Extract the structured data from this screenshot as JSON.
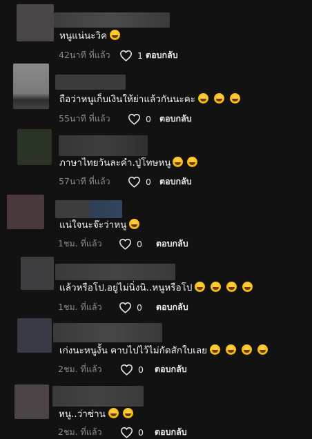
{
  "comments": [
    {
      "text": "หนูแน่นะวิค",
      "emojis": 1,
      "time": "42นาที ที่แล้ว",
      "likes": "1",
      "reply": "ตอบกลับ"
    },
    {
      "text": "ถือว่าหนูเก็บเงินให้ย่าแล้วกันนะคะ",
      "emojis": 3,
      "time": "55นาที ที่แล้ว",
      "likes": "0",
      "reply": "ตอบกลับ"
    },
    {
      "text": "ภาษาไทยวันละคำ.ปู่โทษหนู",
      "emojis": 2,
      "time": "57นาที ที่แล้ว",
      "likes": "0",
      "reply": "ตอบกลับ"
    },
    {
      "text": "แน่ใจนะจ๊ะว่าหนู",
      "emojis": 1,
      "time": "1ชม. ที่แล้ว",
      "likes": "0",
      "reply": "ตอบกลับ"
    },
    {
      "text": "แล้วหรือโป.อยู่ไม่นิ่งนิ..หนูหรือโป",
      "emojis": 4,
      "time": "1ชม. ที่แล้ว",
      "likes": "0",
      "reply": "ตอบกลับ"
    },
    {
      "text": "เก่งนะหนูงั้น คาบไปไว้ไม่กัดสักใบเลย",
      "emojis": 4,
      "time": "2ชม. ที่แล้ว",
      "likes": "0",
      "reply": "ตอบกลับ"
    },
    {
      "text": "หนู..ว่าซ่าน",
      "emojis": 2,
      "time": "2ชม. ที่แล้ว",
      "likes": "0",
      "reply": "ตอบกลับ"
    }
  ],
  "icons": {
    "like": "heart-outline-icon",
    "emoji": "laughing-face-emoji-icon"
  },
  "colors": {
    "background": "#121212",
    "time": "#8a8a8a",
    "text": "#f2f2f2"
  }
}
